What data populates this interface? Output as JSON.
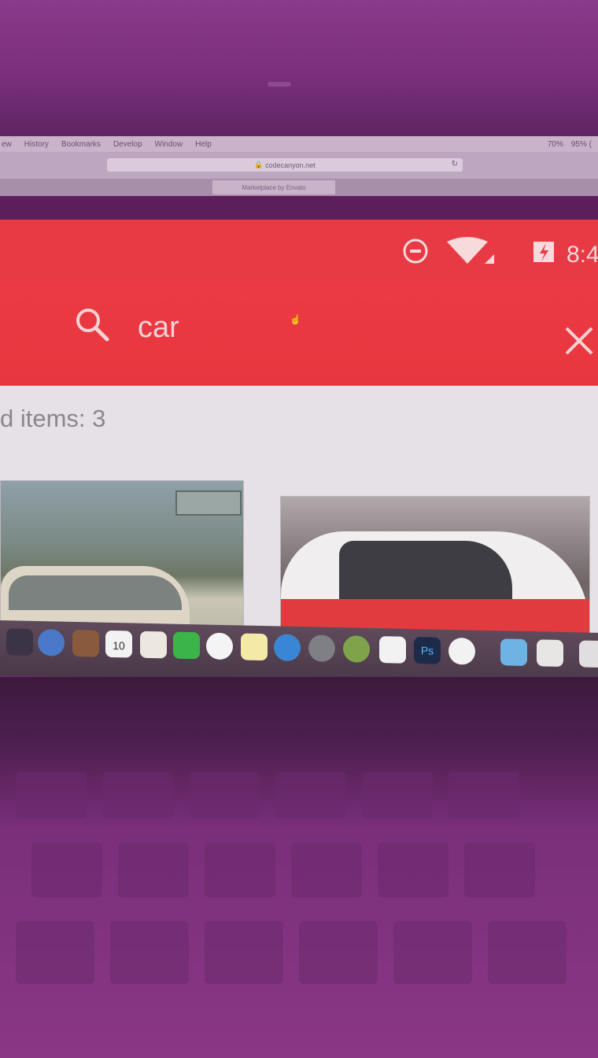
{
  "mac_menubar": {
    "items": [
      "ew",
      "History",
      "Bookmarks",
      "Develop",
      "Window",
      "Help"
    ],
    "battery": "95% (",
    "extra": "70%"
  },
  "browser": {
    "url": "codecanyon.net",
    "active_tab": "Marketplace by Envato"
  },
  "android_status": {
    "time": "8:4"
  },
  "search": {
    "query": "car"
  },
  "results": {
    "found_text": "d items: 3"
  },
  "dock": {
    "calendar_day": "10",
    "ps_label": "Ps"
  },
  "colors": {
    "app_primary": "#e83a44",
    "content_bg": "#e6e1e6"
  }
}
